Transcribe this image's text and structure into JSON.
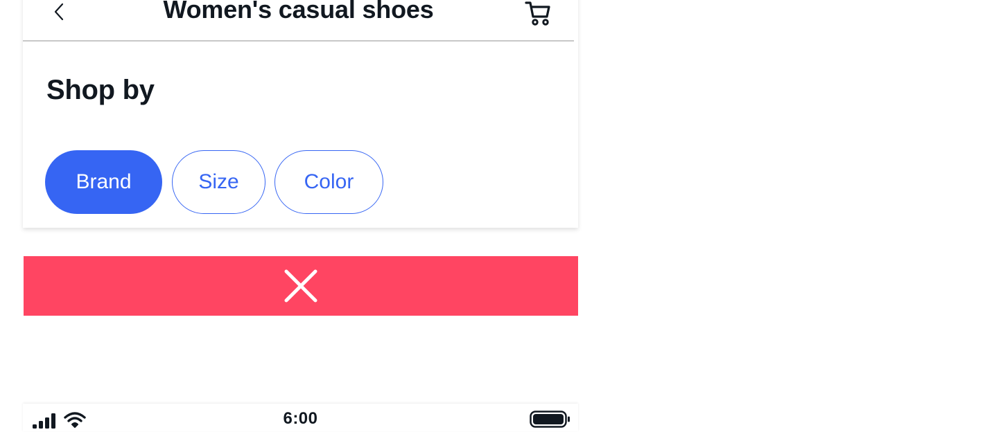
{
  "header": {
    "title": "Women's casual shoes"
  },
  "section": {
    "title": "Shop by",
    "chips": [
      {
        "label": "Brand",
        "selected": true
      },
      {
        "label": "Size",
        "selected": false
      },
      {
        "label": "Color",
        "selected": false
      }
    ]
  },
  "status_bar": {
    "time": "6:00"
  },
  "icons": {
    "back": "chevron-left-icon",
    "cart": "cart-icon",
    "dismiss": "close-icon",
    "signal": "cellular-signal-icon",
    "wifi": "wifi-icon",
    "battery": "battery-icon"
  },
  "colors": {
    "accent": "#3665f3",
    "dismiss_bar": "#ff4562",
    "text": "#111820"
  }
}
